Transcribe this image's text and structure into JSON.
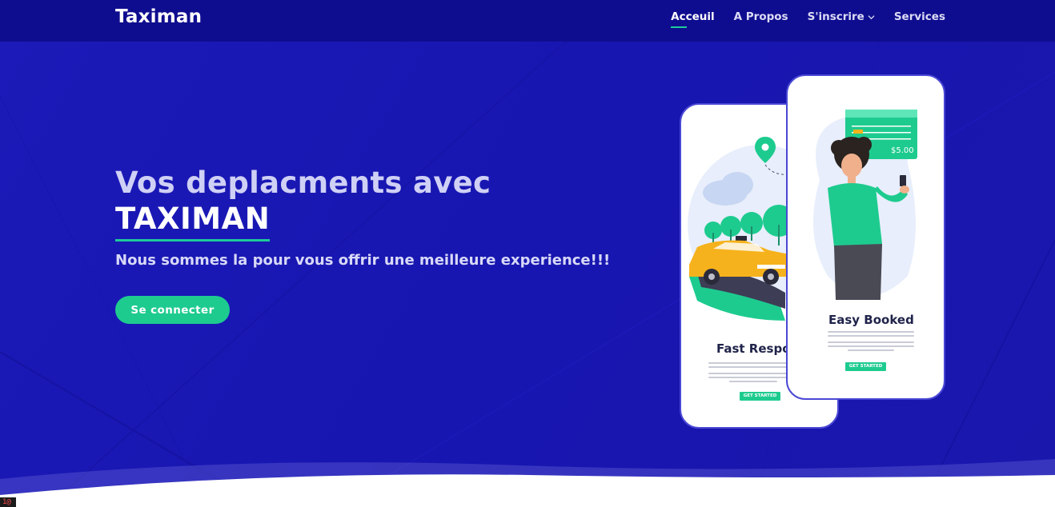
{
  "navbar": {
    "brand": "Taximan",
    "links": [
      {
        "label": "Acceuil",
        "active": true
      },
      {
        "label": "A Propos",
        "active": false
      },
      {
        "label": "S'inscrire",
        "active": false,
        "dropdown": true
      },
      {
        "label": "Services",
        "active": false
      }
    ]
  },
  "hero": {
    "title_line1": "Vos deplacments avec",
    "title_line2": "TAXIMAN",
    "subtitle": "Nous sommes la pour vous offrir une meilleure experience!!!",
    "cta_label": "Se connecter"
  },
  "illustration": {
    "phone1": {
      "title": "Fast Respon",
      "button": "GET STARTED"
    },
    "phone2": {
      "title": "Easy Booked",
      "button": "GET STARTED",
      "price": "$5.00"
    }
  },
  "corner_badge": "1@",
  "colors": {
    "background": "#1a18b4",
    "navbar": "#0f0d8f",
    "accent": "#1ecb8f"
  },
  "icons": [
    "chevron-down-icon",
    "location-pin-icon",
    "taxi-icon",
    "cloud-icon",
    "tree-icon",
    "smartphone-icon"
  ]
}
